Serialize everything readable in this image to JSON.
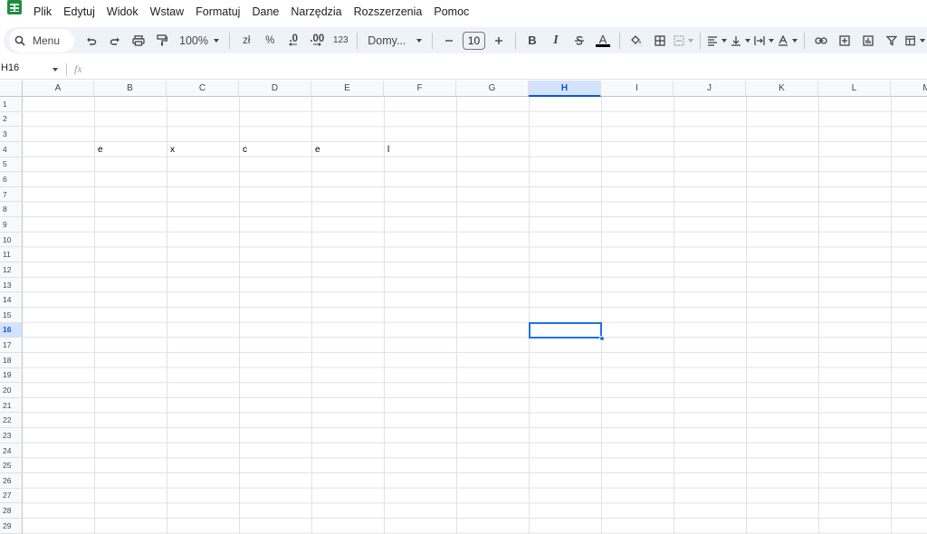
{
  "menu": {
    "items": [
      "Plik",
      "Edytuj",
      "Widok",
      "Wstaw",
      "Formatuj",
      "Dane",
      "Narzędzia",
      "Rozszerzenia",
      "Pomoc"
    ]
  },
  "toolbar": {
    "menu_label": "Menu",
    "zoom": "100%",
    "currency": "zł",
    "percent": "%",
    "decimal_decrease": ".0",
    "decimal_increase": ".00",
    "number_format": "123",
    "font": "Domy...",
    "font_size": "10",
    "bold": "B",
    "italic": "I",
    "text_color_letter": "A",
    "accent_color": "#0b57d0",
    "toolbar_bg": "#eef2f9"
  },
  "formula_bar": {
    "name_box": "H16",
    "fx_label": "fx",
    "value": ""
  },
  "grid": {
    "columns": [
      "A",
      "B",
      "C",
      "D",
      "E",
      "F",
      "G",
      "H",
      "I",
      "J",
      "K",
      "L",
      "M"
    ],
    "rows": [
      "1",
      "2",
      "3",
      "4",
      "5",
      "6",
      "7",
      "8",
      "9",
      "10",
      "11",
      "12",
      "13",
      "14",
      "15",
      "16",
      "17",
      "18",
      "19",
      "20",
      "21",
      "22",
      "23",
      "24",
      "25",
      "26",
      "27",
      "28",
      "29"
    ],
    "active_column": "H",
    "active_row": "16",
    "cells": [
      {
        "ref": "B4",
        "value": "e"
      },
      {
        "ref": "C4",
        "value": "x"
      },
      {
        "ref": "D4",
        "value": "c"
      },
      {
        "ref": "E4",
        "value": "e"
      },
      {
        "ref": "F4",
        "value": "l"
      }
    ]
  }
}
